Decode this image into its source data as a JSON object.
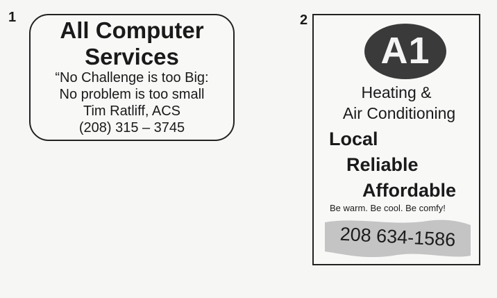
{
  "ads": [
    {
      "number": "1",
      "title_line1": "All Computer",
      "title_line2": "Services",
      "lines": [
        "“No Challenge is too Big:",
        "No problem is too small",
        "Tim Ratliff, ACS",
        "(208) 315 – 3745"
      ]
    },
    {
      "number": "2",
      "logo": "A1",
      "heading_line1": "Heating &",
      "heading_line2": "Air Conditioning",
      "tags": [
        "Local",
        "Reliable",
        "Affordable"
      ],
      "slogan": "Be warm. Be cool. Be comfy!",
      "phone": "208 634-1586"
    }
  ],
  "colors": {
    "background": "#f6f6f4",
    "ink": "#1a1a1a",
    "logo_fill": "#3a3a3a",
    "phone_band": "#c4c4c4"
  }
}
